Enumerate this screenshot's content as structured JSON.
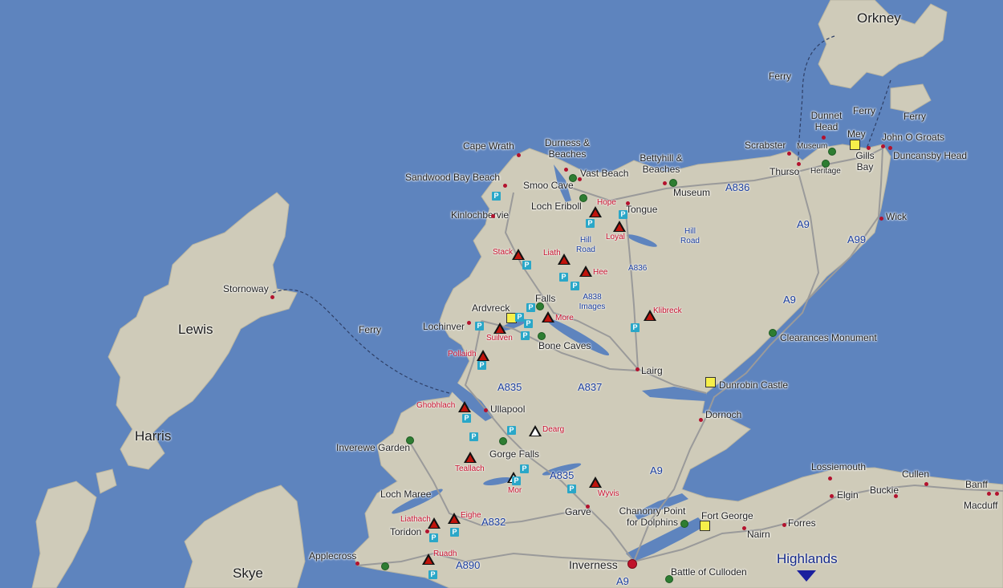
{
  "map": {
    "region_label": "Highlands",
    "colors": {
      "sea": "#5e84be",
      "land": "#cfcbb9",
      "road": "#9a9a9a",
      "peak": "#c0140c",
      "parking": "#2aa7c8",
      "park_site": "#2e7d32",
      "castle": "#f6ef4a"
    },
    "places": {
      "orkney": "Orkney",
      "lewis": "Lewis",
      "harris": "Harris",
      "skye": "Skye",
      "stornoway": "Stornoway",
      "cape_wrath": "Cape Wrath",
      "durness_beaches": "Durness & Beaches",
      "sandwood": "Sandwood Bay Beach",
      "vast_beach": "Vast Beach",
      "smoo_cave": "Smoo Cave",
      "bettyhill": "Bettyhill  & Beaches",
      "museum_bettyhill": "Museum",
      "loch_eriboll": "Loch Eriboll",
      "kinlochbervie": "Kinlochbervie",
      "tongue": "Tongue",
      "thurso": "Thurso",
      "scrabster": "Scrabster",
      "museum_thurso": "Museum",
      "heritage": "Heritage",
      "dunnet_head": "Dunnet Head",
      "mey": "Mey",
      "gills_bay": "Gills Bay",
      "john_o_groats": "John O Groats",
      "duncansby": "Duncansby Head",
      "wick": "Wick",
      "falls": "Falls",
      "ardvreck": "Ardvreck",
      "lochinver": "Lochinver",
      "bone_caves": "Bone Caves",
      "lairg": "Lairg",
      "clearances": "Clearances Monument",
      "dunrobin": "Dunrobin Castle",
      "dornoch": "Dornoch",
      "ullapool": "Ullapool",
      "inverewe": "Inverewe Garden",
      "gorge_falls": "Gorge Falls",
      "loch_maree": "Loch Maree",
      "torridon": "Toridon",
      "applecross": "Applecross",
      "garve": "Garve",
      "chanonry": "Chanonry Point for Dolphins",
      "fort_george": "Fort George",
      "nairn": "Nairn",
      "forres": "Forres",
      "inverness": "Inverness",
      "culloden": "Battle of Culloden",
      "lossiemouth": "Lossiemouth",
      "elgin": "Elgin",
      "buckie": "Buckie",
      "cullen": "Cullen",
      "banff": "Banff",
      "macduff": "Macduff"
    },
    "ferries": {
      "f1": "Ferry",
      "f2": "Ferry",
      "f3": "Ferry",
      "f4": "Ferry"
    },
    "roads": {
      "a836_n": "A836",
      "a836_m": "A836",
      "a9_n": "A9",
      "a99": "A99",
      "a9_m": "A9",
      "a835_n": "A835",
      "a837": "A837",
      "a835_s": "A835",
      "a9_s": "A9",
      "a832": "A832",
      "a890": "A890",
      "a9_inv": "A9",
      "hill_road_1": "Hill Road",
      "hill_road_2": "Hill Road",
      "a838_images": "A838 Images"
    },
    "peaks": {
      "hope": "Hope",
      "loyal": "Loyal",
      "stack": "Stack",
      "liath": "Liath",
      "hee": "Hee",
      "more": "More",
      "klibreck": "Klibreck",
      "suilven": "Suilven",
      "pollaidh": "Pollaidh",
      "ghobhlach": "Ghobhlach",
      "dearg": "Dearg",
      "teallach": "Teallach",
      "mor": "Mor",
      "wyvis": "Wyvis",
      "liathach": "Liathach",
      "eighe": "Eighe",
      "ruadh": "Ruadh"
    },
    "parking_symbol": "P"
  }
}
